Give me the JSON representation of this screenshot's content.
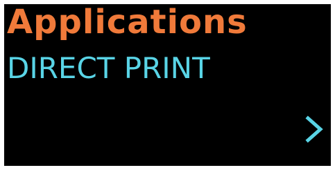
{
  "screen": {
    "title": "Applications",
    "item_label": "DIRECT PRINT",
    "next_icon": "chevron-right-icon"
  },
  "colors": {
    "background": "#000000",
    "title": "#f07a3a",
    "item": "#59d4e6",
    "arrow": "#59d4e6"
  }
}
